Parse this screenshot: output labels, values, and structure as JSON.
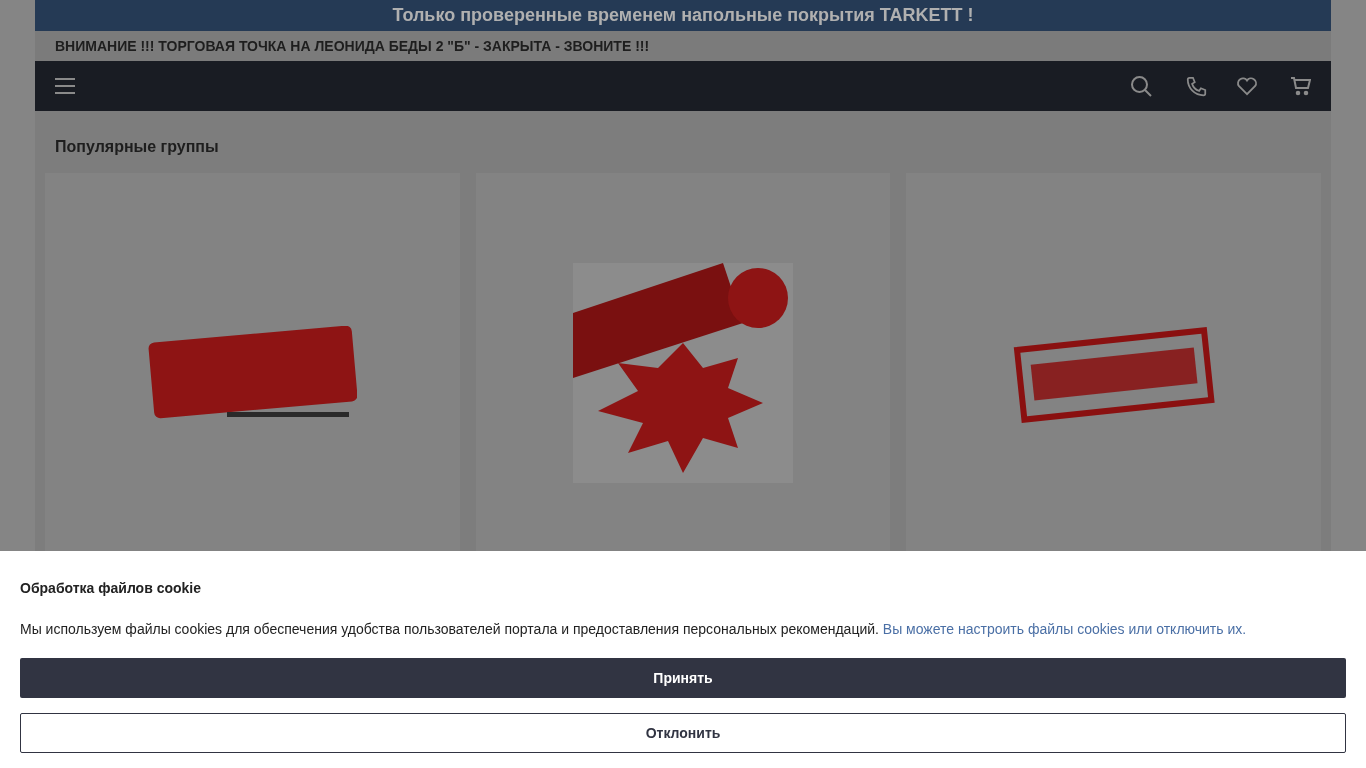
{
  "promo_banner": {
    "text": "Только проверенные временем напольные покрытия TARKETT !"
  },
  "notice": {
    "text": "ВНИМАНИЕ !!! ТОРГОВАЯ ТОЧКА НА ЛЕОНИДА БЕДЫ 2 \"Б\" - ЗАКРЫТА - ЗВОНИТЕ !!!"
  },
  "section": {
    "title": "Популярные группы",
    "cards": [
      {
        "kind": "sticker"
      },
      {
        "kind": "burst"
      },
      {
        "kind": "stamp"
      }
    ]
  },
  "cookie_dialog": {
    "title": "Обработка файлов cookie",
    "text": "Мы используем файлы cookies для обеспечения удобства пользователей портала и предоставления персональных рекомендаций.",
    "link": "Вы можете настроить файлы cookies или отключить их.",
    "buttons": [
      {
        "label": "Принять",
        "kind": "primary"
      },
      {
        "label": "Отклонить",
        "kind": "outline"
      }
    ]
  }
}
